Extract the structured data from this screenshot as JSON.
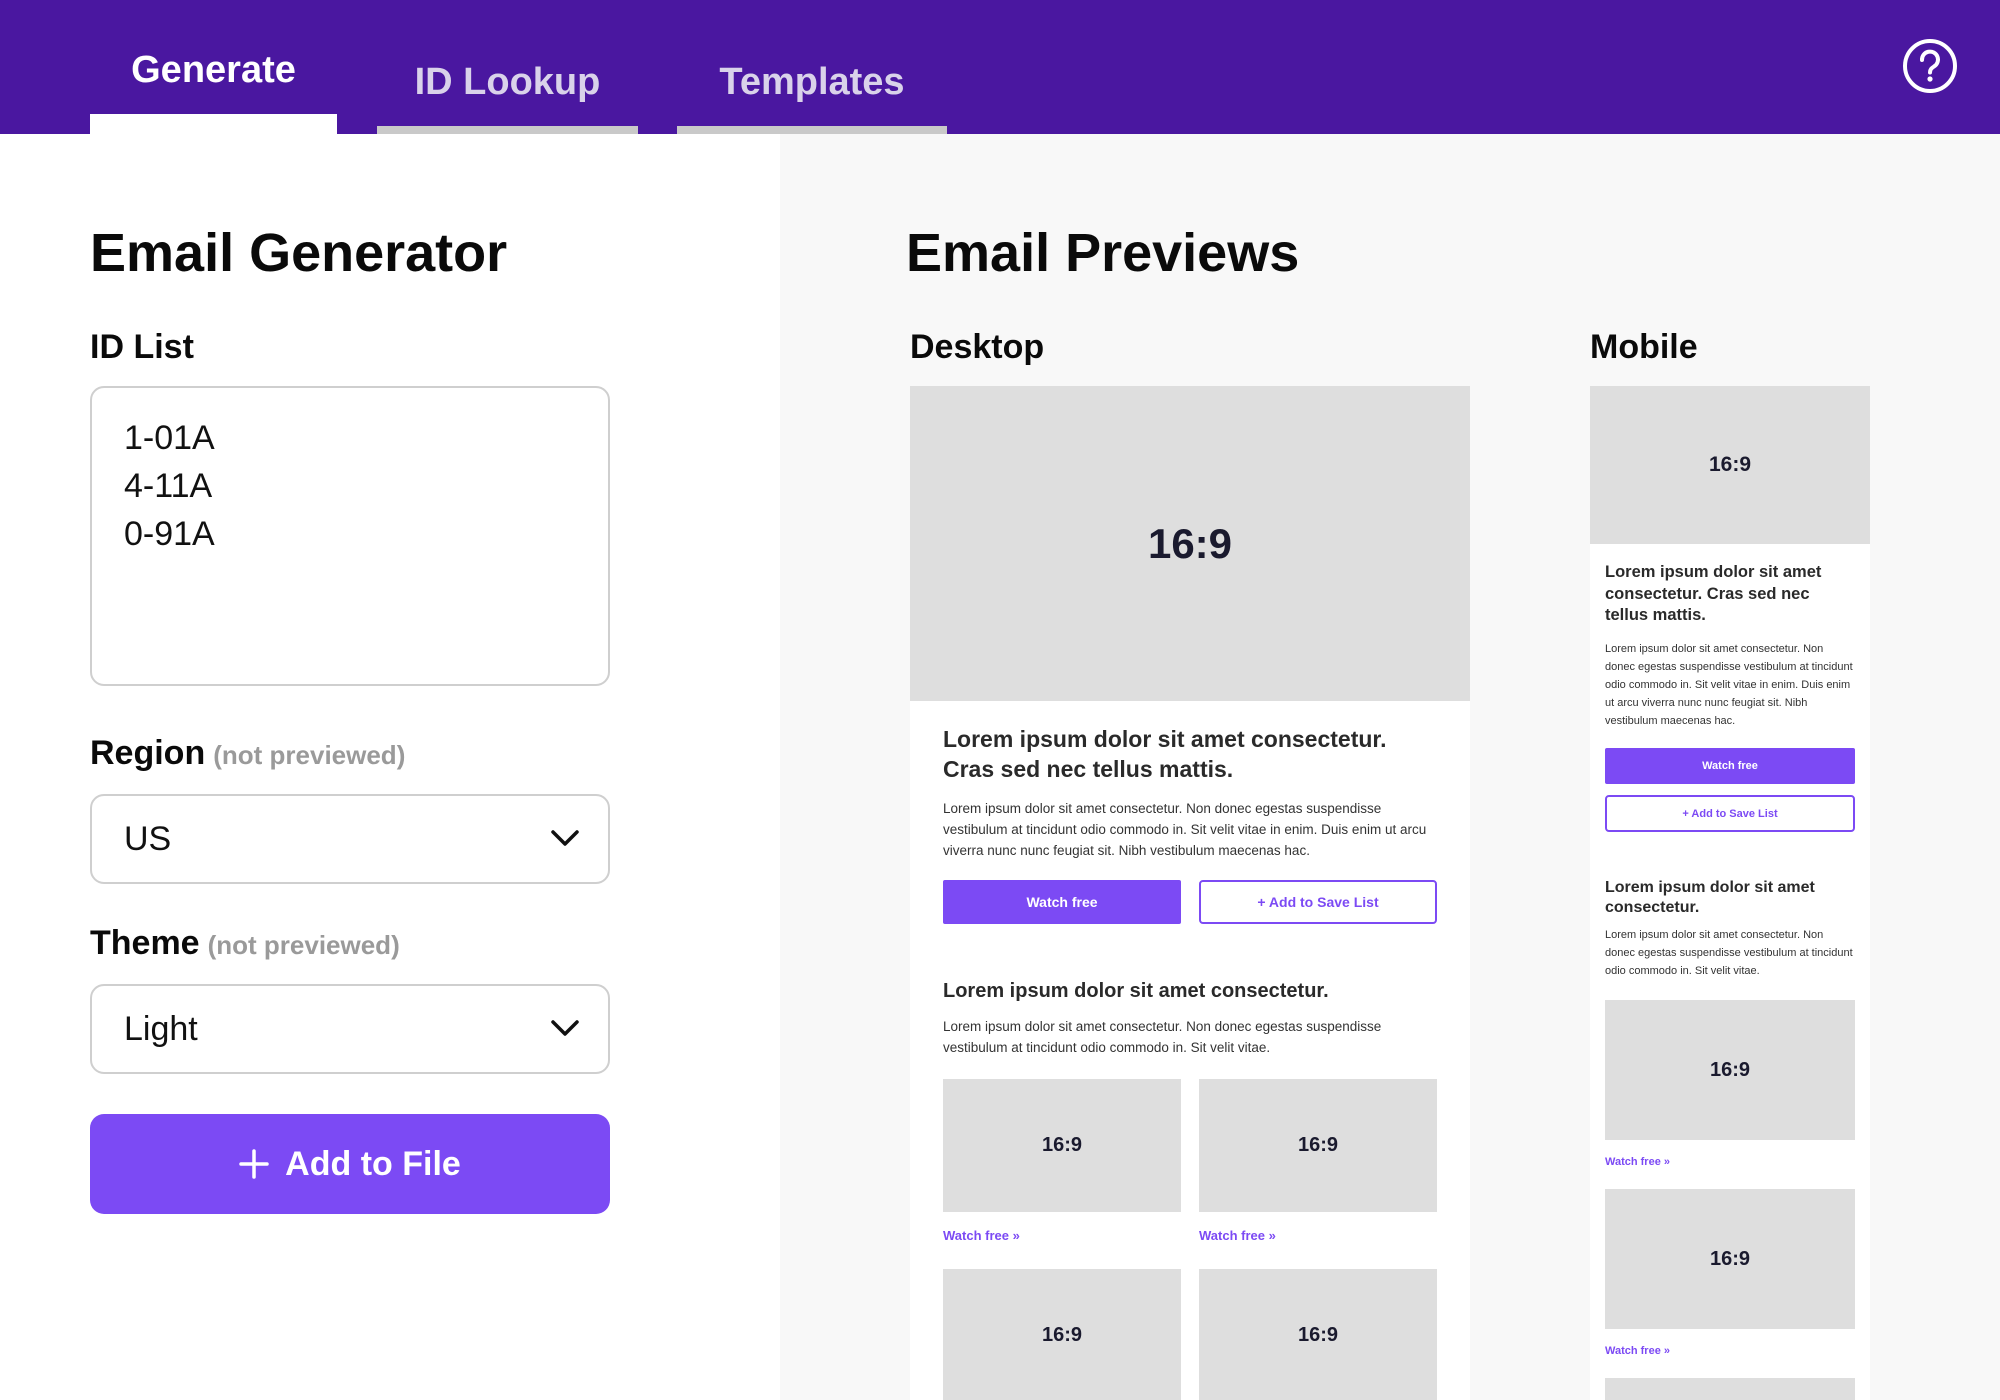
{
  "tabs": [
    {
      "label": "Generate",
      "active": true
    },
    {
      "label": "ID Lookup",
      "active": false
    },
    {
      "label": "Templates",
      "active": false
    }
  ],
  "help": {
    "icon": "help-circle-icon"
  },
  "generator": {
    "title": "Email Generator",
    "id_list_label": "ID List",
    "id_list_lines": [
      "1-01A",
      "4-11A",
      "0-91A"
    ],
    "region_label": "Region",
    "region_note": "(not previewed)",
    "region_value": "US",
    "theme_label": "Theme",
    "theme_note": "(not previewed)",
    "theme_value": "Light",
    "add_button": "Add to File"
  },
  "previews": {
    "title": "Email Previews",
    "desktop_label": "Desktop",
    "mobile_label": "Mobile",
    "ratio": "16:9",
    "hero_heading": "Lorem ipsum dolor sit amet consectetur. Cras sed nec tellus mattis.",
    "hero_body": "Lorem ipsum dolor sit amet consectetur. Non donec egestas suspendisse vestibulum at tincidunt odio commodo in. Sit velit vitae in enim. Duis enim ut arcu viverra nunc nunc feugiat sit. Nibh vestibulum maecenas hac.",
    "mobile_hero_body": "Lorem ipsum dolor sit amet consectetur. Non donec egestas suspendisse vestibulum at tincidunt odio commodo in. Sit velit vitae in enim. Duis enim ut arcu viverra nunc nunc feugiat sit. Nibh vestibulum maecenas hac.",
    "watch_button": "Watch free",
    "save_button": "+ Add to Save List",
    "section_heading": "Lorem ipsum dolor sit amet consectetur.",
    "section_body": "Lorem ipsum dolor sit amet consectetur. Non donec egestas suspendisse vestibulum at tincidunt odio commodo in. Sit velit vitae.",
    "watch_link": "Watch free »"
  },
  "colors": {
    "topbar": "#4a17a0",
    "accent": "#7c4af4",
    "placeholder": "#dedede"
  }
}
